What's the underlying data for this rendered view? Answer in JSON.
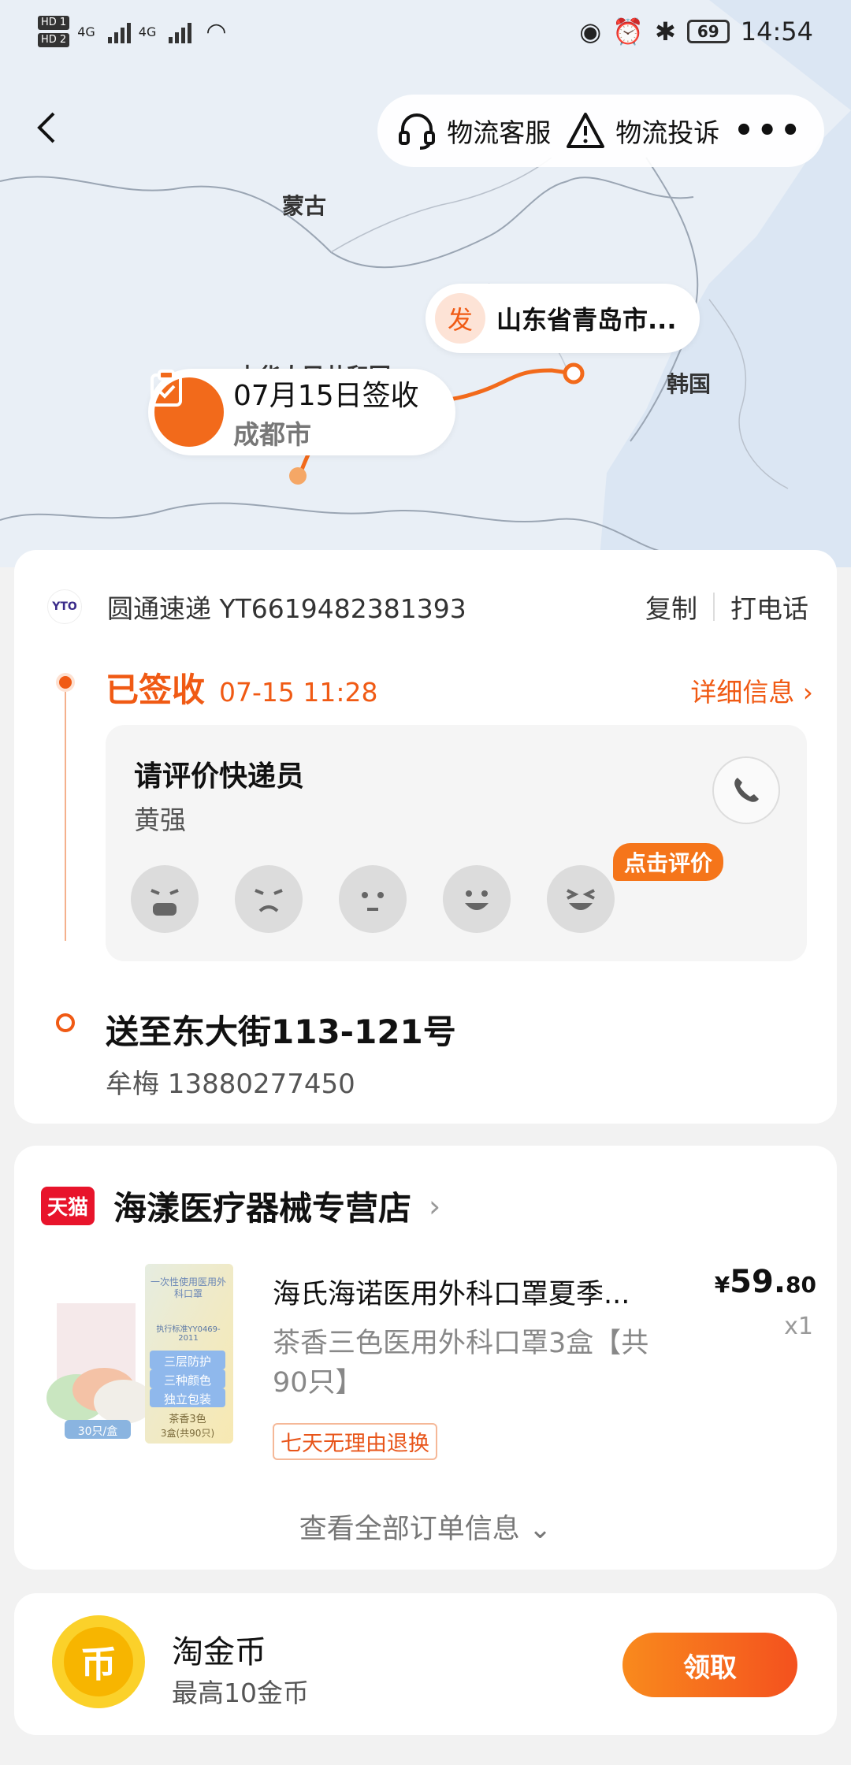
{
  "status_bar": {
    "hd1": "HD 1",
    "hd2": "HD 2",
    "net1": "4G",
    "net2": "4G",
    "battery": "69",
    "time": "14:54"
  },
  "nav": {
    "service_label": "物流客服",
    "complaint_label": "物流投诉",
    "more_label": "•••"
  },
  "map": {
    "labels": {
      "mongolia": "蒙古",
      "china": "中华人民共和国",
      "korea": "韩国"
    },
    "origin_badge": "发",
    "origin_text": "山东省青岛市...",
    "dest_title": "07月15日签收",
    "dest_city": "成都市"
  },
  "tracking": {
    "courier": "圆通速递 YT6619482381393",
    "logo_text": "YTO",
    "copy_label": "复制",
    "call_label": "打电话",
    "status": "已签收",
    "status_time": "07-15 11:28",
    "detail_label": "详细信息 ›",
    "rate_title": "请评价快递员",
    "courier_name": "黄强",
    "rate_tag": "点击评价",
    "address": "送至东大街113-121号",
    "receiver": "牟梅 13880277450"
  },
  "shop": {
    "badge": "天猫",
    "name": "海漾医疗器械专营店",
    "product_title": "海氏海诺医用外科口罩夏季...",
    "product_spec": "茶香三色医用外科口罩3盒【共90只】",
    "service_tag": "七天无理由退换",
    "price_currency": "¥",
    "price_int": "59.",
    "price_dec": "80",
    "qty": "x1",
    "view_all": "查看全部订单信息 ⌄",
    "img_box_text": "一次性使用医用外科口罩",
    "img_std": "执行标准YY0469-2011",
    "img_f1": "三层防护",
    "img_f2": "三种颜色",
    "img_f3": "独立包装",
    "img_flavor": "茶香3色",
    "img_count": "3盒(共90只)",
    "img_pack": "30只/盒"
  },
  "coins": {
    "icon_char": "币",
    "title": "淘金币",
    "subtitle": "最高10金币",
    "button": "领取"
  },
  "colors": {
    "accent": "#f05a14",
    "map_bg": "#e9eff6",
    "tmall_red": "#e8142b"
  }
}
